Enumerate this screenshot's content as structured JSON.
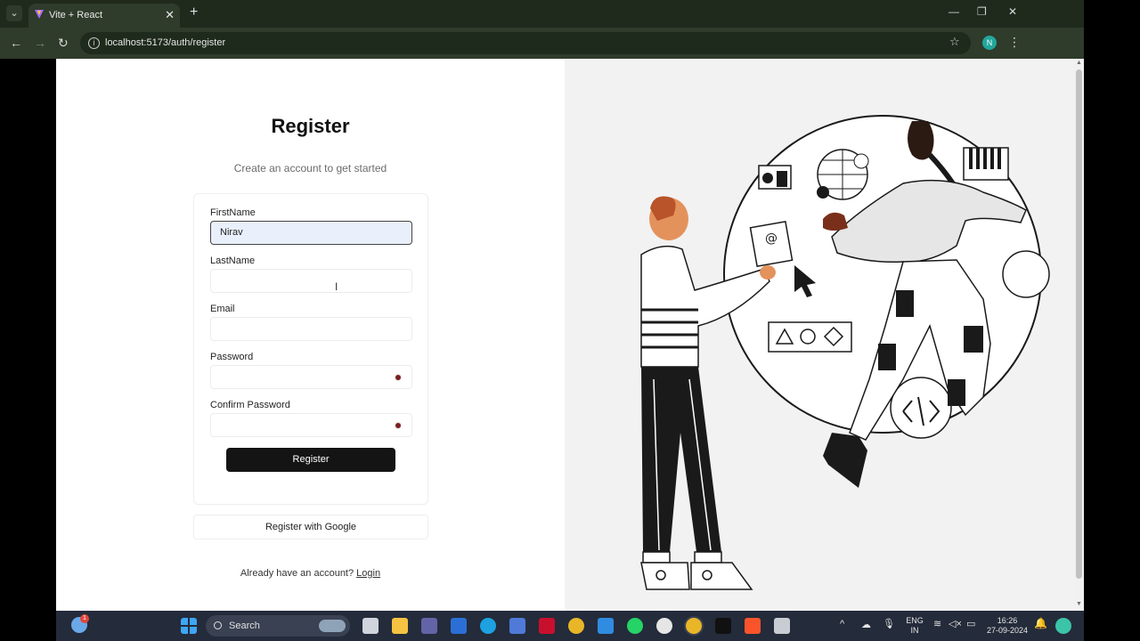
{
  "browser": {
    "tab_title": "Vite + React",
    "url": "localhost:5173/auth/register",
    "profile_initial": "N"
  },
  "page": {
    "title": "Register",
    "subtitle": "Create an account to get started",
    "form": {
      "first_name_label": "FirstName",
      "first_name_value": "Nirav",
      "last_name_label": "LastName",
      "last_name_value": "",
      "email_label": "Email",
      "email_value": "",
      "password_label": "Password",
      "password_value": "",
      "confirm_password_label": "Confirm Password",
      "confirm_password_value": "",
      "submit_label": "Register"
    },
    "google_button_label": "Register with Google",
    "login_prompt": "Already have an account?",
    "login_link": "Login"
  },
  "taskbar": {
    "search_placeholder": "Search",
    "language_top": "ENG",
    "language_bottom": "IN",
    "time": "16:26",
    "date": "27-09-2024",
    "weather_badge": "1"
  },
  "colors": {
    "accent_profile": "#21a79c",
    "primary_button": "#141414",
    "right_panel_bg": "#f2f2f2"
  }
}
